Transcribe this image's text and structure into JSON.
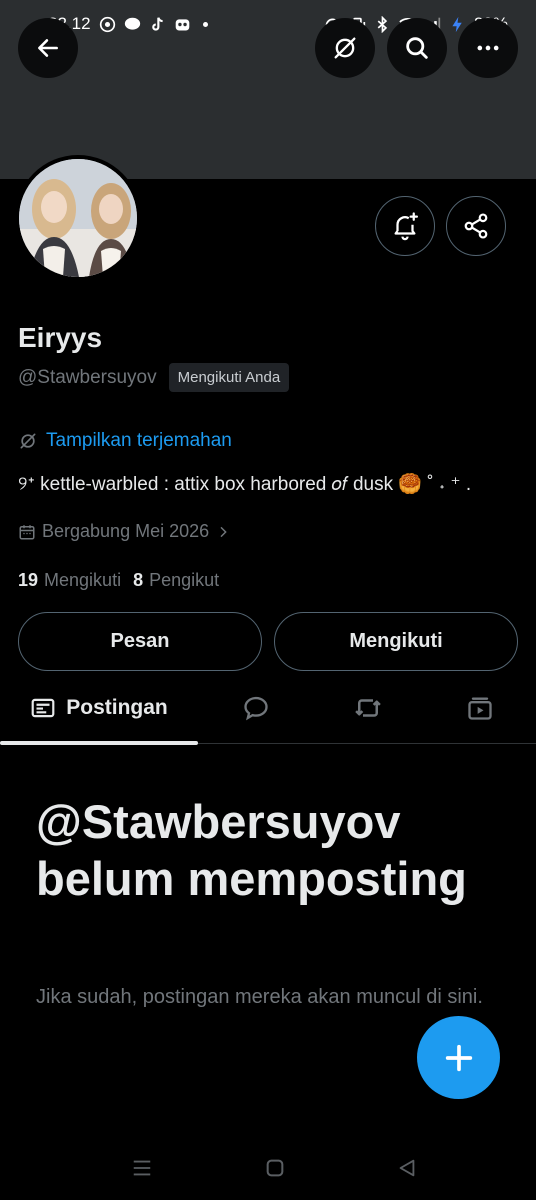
{
  "status_bar": {
    "time": "22.12",
    "battery": "89%"
  },
  "profile": {
    "display_name": "Eiryys",
    "handle": "@Stawbersuyov",
    "follows_you_badge": "Mengikuti Anda",
    "translate_link": "Tampilkan terjemahan",
    "bio": "୨ᕀ kettle-warbled : attix box harbored 𝑜𝑓 dusk 🥮 ˚ ˖ ⁺ .",
    "joined": "Bergabung Mei 2026",
    "following_count": "19",
    "following_label": "Mengikuti",
    "followers_count": "8",
    "followers_label": "Pengikut"
  },
  "actions": {
    "message_label": "Pesan",
    "following_label": "Mengikuti"
  },
  "tabs": [
    {
      "label": "Postingan",
      "icon": "posts-icon",
      "active": true
    },
    {
      "label": "",
      "icon": "replies-icon",
      "active": false
    },
    {
      "label": "",
      "icon": "reposts-icon",
      "active": false
    },
    {
      "label": "",
      "icon": "media-icon",
      "active": false
    }
  ],
  "empty_state": {
    "title": "@Stawbersuyov belum memposting",
    "subtitle": "Jika sudah, postingan mereka akan muncul di sini."
  },
  "colors": {
    "accent": "#1d9bf0",
    "background": "#000000",
    "banner": "#2b2e30",
    "muted_text": "#71767b"
  }
}
